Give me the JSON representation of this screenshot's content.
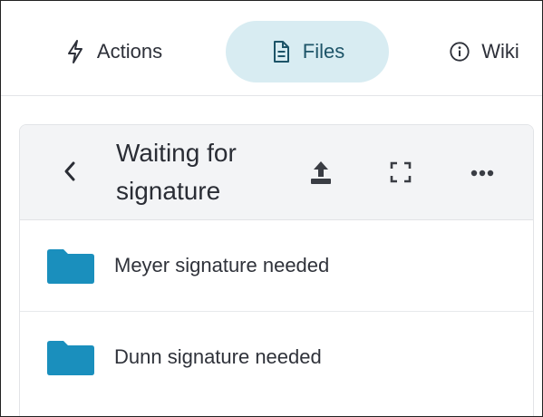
{
  "tabs": [
    {
      "label": "Actions",
      "icon": "lightning-icon",
      "active": false
    },
    {
      "label": "Files",
      "icon": "file-icon",
      "active": true
    },
    {
      "label": "Wiki",
      "icon": "info-icon",
      "active": false
    }
  ],
  "panel": {
    "title": "Waiting for signature",
    "header_icons": [
      "back-chevron-icon",
      "upload-icon",
      "expand-icon",
      "more-icon"
    ],
    "items": [
      {
        "label": "Meyer signature needed",
        "icon": "folder-icon"
      },
      {
        "label": "Dunn signature needed",
        "icon": "folder-icon"
      }
    ]
  },
  "colors": {
    "accent_tab_bg": "#d8ecf2",
    "accent_tab_text": "#1d5468",
    "folder": "#1a8fbd",
    "header_bg": "#f3f4f6",
    "text": "#2b2f38"
  }
}
